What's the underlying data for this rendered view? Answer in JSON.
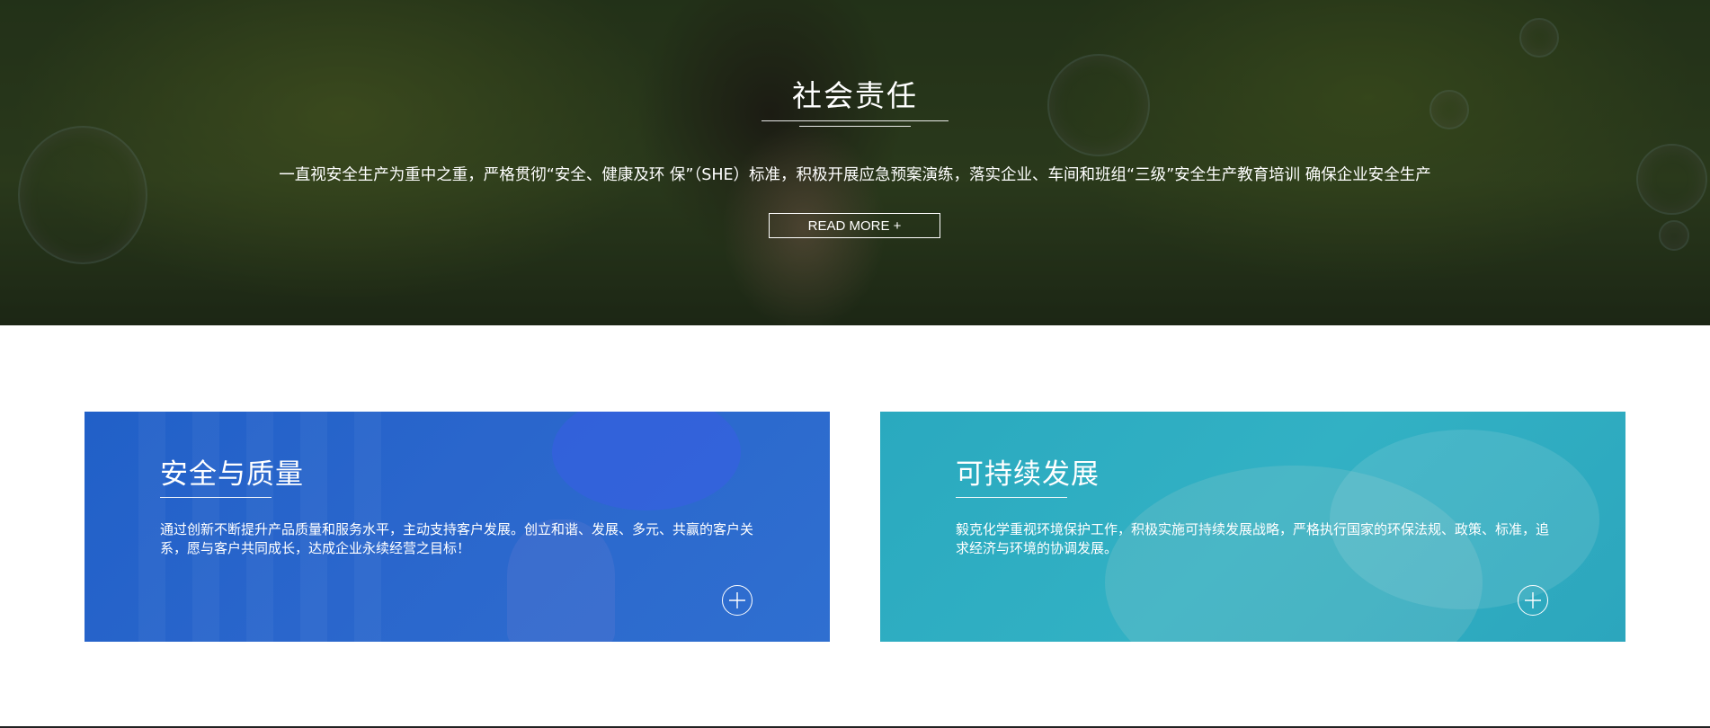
{
  "hero": {
    "title": "社会责任",
    "description": "一直视安全生产为重中之重，严格贯彻“安全、健康及环 保”（SHE）标准，积极开展应急预案演练，落实企业、车间和班组“三级”安全生产教育培训 确保企业安全生产",
    "button_label": "READ MORE +"
  },
  "cards": [
    {
      "title": "安全与质量",
      "text": "通过创新不断提升产品质量和服务水平，主动支持客户发展。创立和谐、发展、多元、共赢的客户关系，愿与客户共同成长，达成企业永续经营之目标！",
      "icon": "plus-circle-icon",
      "color": "#2463c9"
    },
    {
      "title": "可持续发展",
      "text": "毅克化学重视环境保护工作，积极实施可持续发展战略，严格执行国家的环保法规、政策、标准，追求经济与环境的协调发展。",
      "icon": "plus-circle-icon",
      "color": "#2eaec2"
    }
  ]
}
